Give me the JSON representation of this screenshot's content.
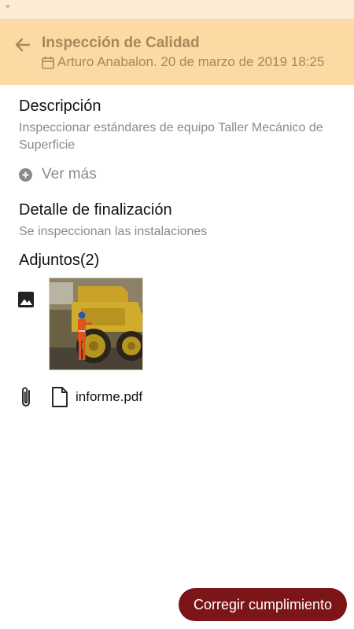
{
  "header": {
    "title": "Inspección de Calidad",
    "subtitle": "Arturo Anabalon. 20 de marzo de 2019 18:25"
  },
  "descripcion": {
    "title": "Descripción",
    "text": "Inspeccionar estándares de equipo Taller Mecánico de Superficie",
    "more_label": "Ver más"
  },
  "detalle": {
    "title": "Detalle de finalización",
    "text": "Se inspeccionan las instalaciones"
  },
  "adjuntos": {
    "title": "Adjuntos(2)",
    "files": [
      {
        "name": "informe.pdf"
      }
    ]
  },
  "actions": {
    "primary_label": "Corregir cumplimiento"
  },
  "colors": {
    "header_bg": "#fdd9a4",
    "header_text": "#a8875a",
    "primary_button": "#7b1518"
  }
}
